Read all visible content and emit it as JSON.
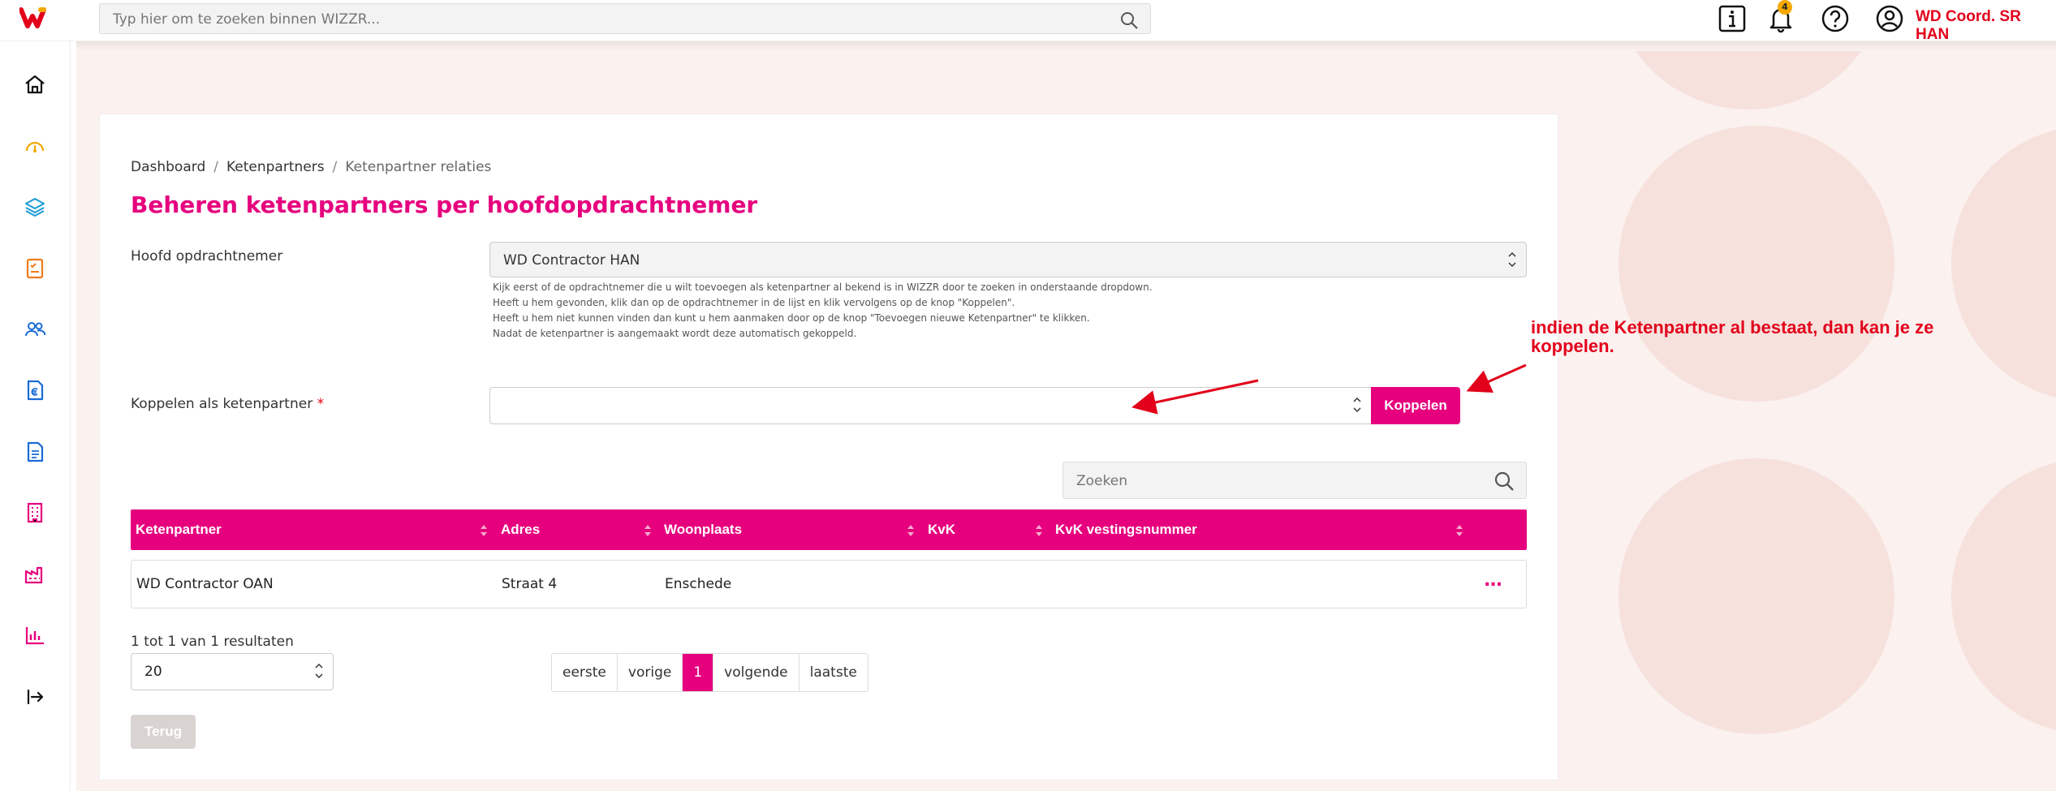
{
  "header": {
    "search_placeholder": "Typ hier om te zoeken binnen WIZZR...",
    "notification_count": "4",
    "user_name": "WD Coord. SR HAN"
  },
  "sidebar": {
    "items": [
      {
        "icon": "home-icon"
      },
      {
        "icon": "gauge-icon"
      },
      {
        "icon": "layers-icon"
      },
      {
        "icon": "checklist-icon"
      },
      {
        "icon": "users-icon"
      },
      {
        "icon": "euro-document-icon"
      },
      {
        "icon": "document-icon"
      },
      {
        "icon": "building-icon"
      },
      {
        "icon": "factory-icon"
      },
      {
        "icon": "bar-chart-icon"
      },
      {
        "icon": "logout-icon"
      }
    ]
  },
  "breadcrumb": {
    "items": [
      "Dashboard",
      "Ketenpartners",
      "Ketenpartner relaties"
    ],
    "separator": "/"
  },
  "page_title": "Beheren ketenpartners per hoofdopdrachtnemer",
  "form": {
    "hoofd_label": "Hoofd opdrachtnemer",
    "hoofd_value": "WD Contractor HAN",
    "help_lines": [
      "Kijk eerst of de opdrachtnemer die u wilt toevoegen als ketenpartner al bekend is in WIZZR door te zoeken in onderstaande dropdown.",
      "Heeft u hem gevonden, klik dan op de opdrachtnemer in de lijst en klik vervolgens op de knop \"Koppelen\".",
      "Heeft u hem niet kunnen vinden dan kunt u hem aanmaken door op de knop \"Toevoegen nieuwe Ketenpartner\" te klikken.",
      "Nadat de ketenpartner is aangemaakt wordt deze automatisch gekoppeld."
    ],
    "koppelen_label": "Koppelen als ketenpartner",
    "required_mark": "*",
    "koppelen_value": "",
    "koppelen_button": "Koppelen"
  },
  "table": {
    "search_placeholder": "Zoeken",
    "columns": [
      "Ketenpartner",
      "Adres",
      "Woonplaats",
      "KvK",
      "KvK vestingsnummer"
    ],
    "rows": [
      {
        "ketenpartner": "WD Contractor OAN",
        "adres": "Straat 4",
        "woonplaats": "Enschede",
        "kvk": "",
        "kvk_vestigingsnummer": ""
      }
    ],
    "actions_label": "..."
  },
  "pagination": {
    "results_text": "1 tot 1 van 1 resultaten",
    "page_size": "20",
    "buttons": [
      "eerste",
      "vorige",
      "1",
      "volgende",
      "laatste"
    ],
    "active_page": "1"
  },
  "back_button": "Terug",
  "annotation": {
    "text": "indien de Ketenpartner al bestaat, dan kan je ze koppelen.",
    "color": "#e2001a"
  },
  "colors": {
    "brand": "#e6007e",
    "accent_red": "#e2001a",
    "badge": "#f5a800"
  }
}
